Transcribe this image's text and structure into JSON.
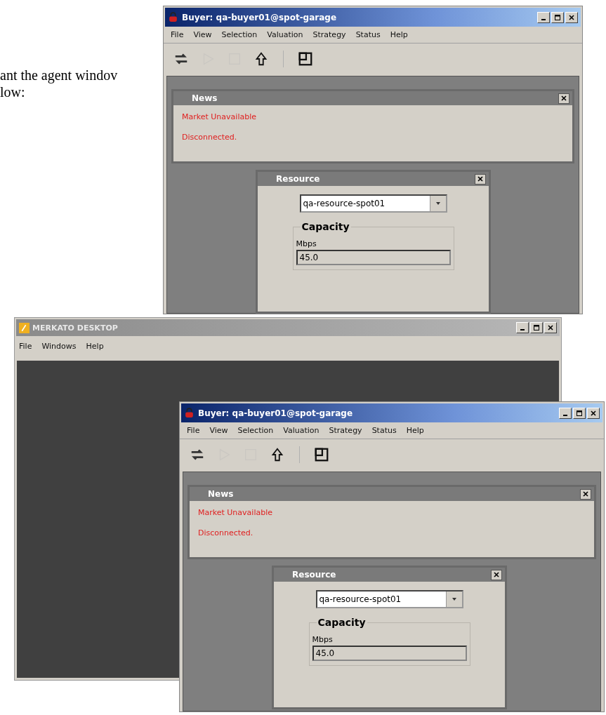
{
  "document_text": [
    "ant the agent windov",
    "low:"
  ],
  "desktop": {
    "title": "MERKATO DESKTOP",
    "menu": [
      "File",
      "Windows",
      "Help"
    ]
  },
  "buyer_windows": [
    {
      "title": "Buyer: qa-buyer01@spot-garage",
      "menu": [
        "File",
        "View",
        "Selection",
        "Valuation",
        "Strategy",
        "Status",
        "Help"
      ],
      "toolbar": [
        {
          "kind": "swap",
          "disabled": false
        },
        {
          "kind": "play",
          "disabled": true
        },
        {
          "kind": "stop",
          "disabled": true
        },
        {
          "kind": "up",
          "disabled": false
        },
        {
          "kind": "separator"
        },
        {
          "kind": "tile",
          "disabled": false
        }
      ],
      "news": {
        "title": "News",
        "messages": [
          "Market Unavailable",
          "Disconnected."
        ]
      },
      "resource": {
        "title": "Resource",
        "selector": "qa-resource-spot01",
        "group": "Capacity",
        "field_label": "Mbps",
        "value": "45.0"
      }
    },
    {
      "title": "Buyer: qa-buyer01@spot-garage",
      "menu": [
        "File",
        "View",
        "Selection",
        "Valuation",
        "Strategy",
        "Status",
        "Help"
      ],
      "toolbar": [
        {
          "kind": "swap",
          "disabled": false
        },
        {
          "kind": "play",
          "disabled": true
        },
        {
          "kind": "stop",
          "disabled": true
        },
        {
          "kind": "up",
          "disabled": false
        },
        {
          "kind": "separator"
        },
        {
          "kind": "tile",
          "disabled": false
        }
      ],
      "news": {
        "title": "News",
        "messages": [
          "Market Unavailable",
          "Disconnected."
        ]
      },
      "resource": {
        "title": "Resource",
        "selector": "qa-resource-spot01",
        "group": "Capacity",
        "field_label": "Mbps",
        "value": "45.0"
      }
    }
  ]
}
